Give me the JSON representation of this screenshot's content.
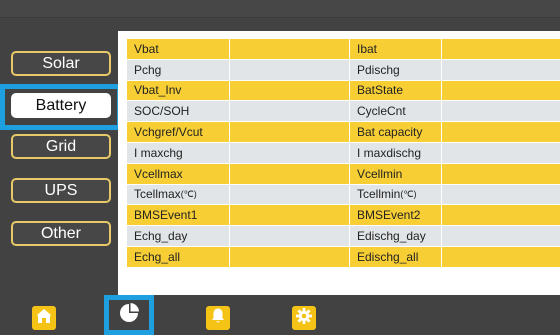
{
  "sidebar": {
    "items": [
      {
        "label": "Solar"
      },
      {
        "label": "Battery"
      },
      {
        "label": "Grid"
      },
      {
        "label": "UPS"
      },
      {
        "label": "Other"
      }
    ]
  },
  "table": {
    "rows": [
      {
        "a": "Vbat",
        "b": "",
        "c": "Ibat",
        "d": ""
      },
      {
        "a": "Pchg",
        "b": "",
        "c": "Pdischg",
        "d": ""
      },
      {
        "a": "Vbat_Inv",
        "b": "",
        "c": "BatState",
        "d": ""
      },
      {
        "a": "SOC/SOH",
        "b": "",
        "c": "CycleCnt",
        "d": ""
      },
      {
        "a": "Vchgref/Vcut",
        "b": "",
        "c": "Bat capacity",
        "d": ""
      },
      {
        "a": "I maxchg",
        "b": "",
        "c": "I maxdischg",
        "d": ""
      },
      {
        "a": "Vcellmax",
        "b": "",
        "c": "Vcellmin",
        "d": ""
      },
      {
        "a": "Tcellmax",
        "a_unit": "(℃)",
        "b": "",
        "c": "Tcellmin",
        "c_unit": "(℃)",
        "d": ""
      },
      {
        "a": "BMSEvent1",
        "b": "",
        "c": "BMSEvent2",
        "d": ""
      },
      {
        "a": "Echg_day",
        "b": "",
        "c": "Edischg_day",
        "d": ""
      },
      {
        "a": "Echg_all",
        "b": "",
        "c": "Edischg_all",
        "d": ""
      }
    ]
  },
  "bottom_nav": {
    "items": [
      {
        "icon": "home-icon"
      },
      {
        "icon": "pie-chart-icon"
      },
      {
        "icon": "bell-icon"
      },
      {
        "icon": "gear-icon"
      }
    ]
  },
  "colors": {
    "accent": "#1e9fe0",
    "yellow": "#f7cf35",
    "gray": "#e1e5e8",
    "background": "#424242"
  }
}
